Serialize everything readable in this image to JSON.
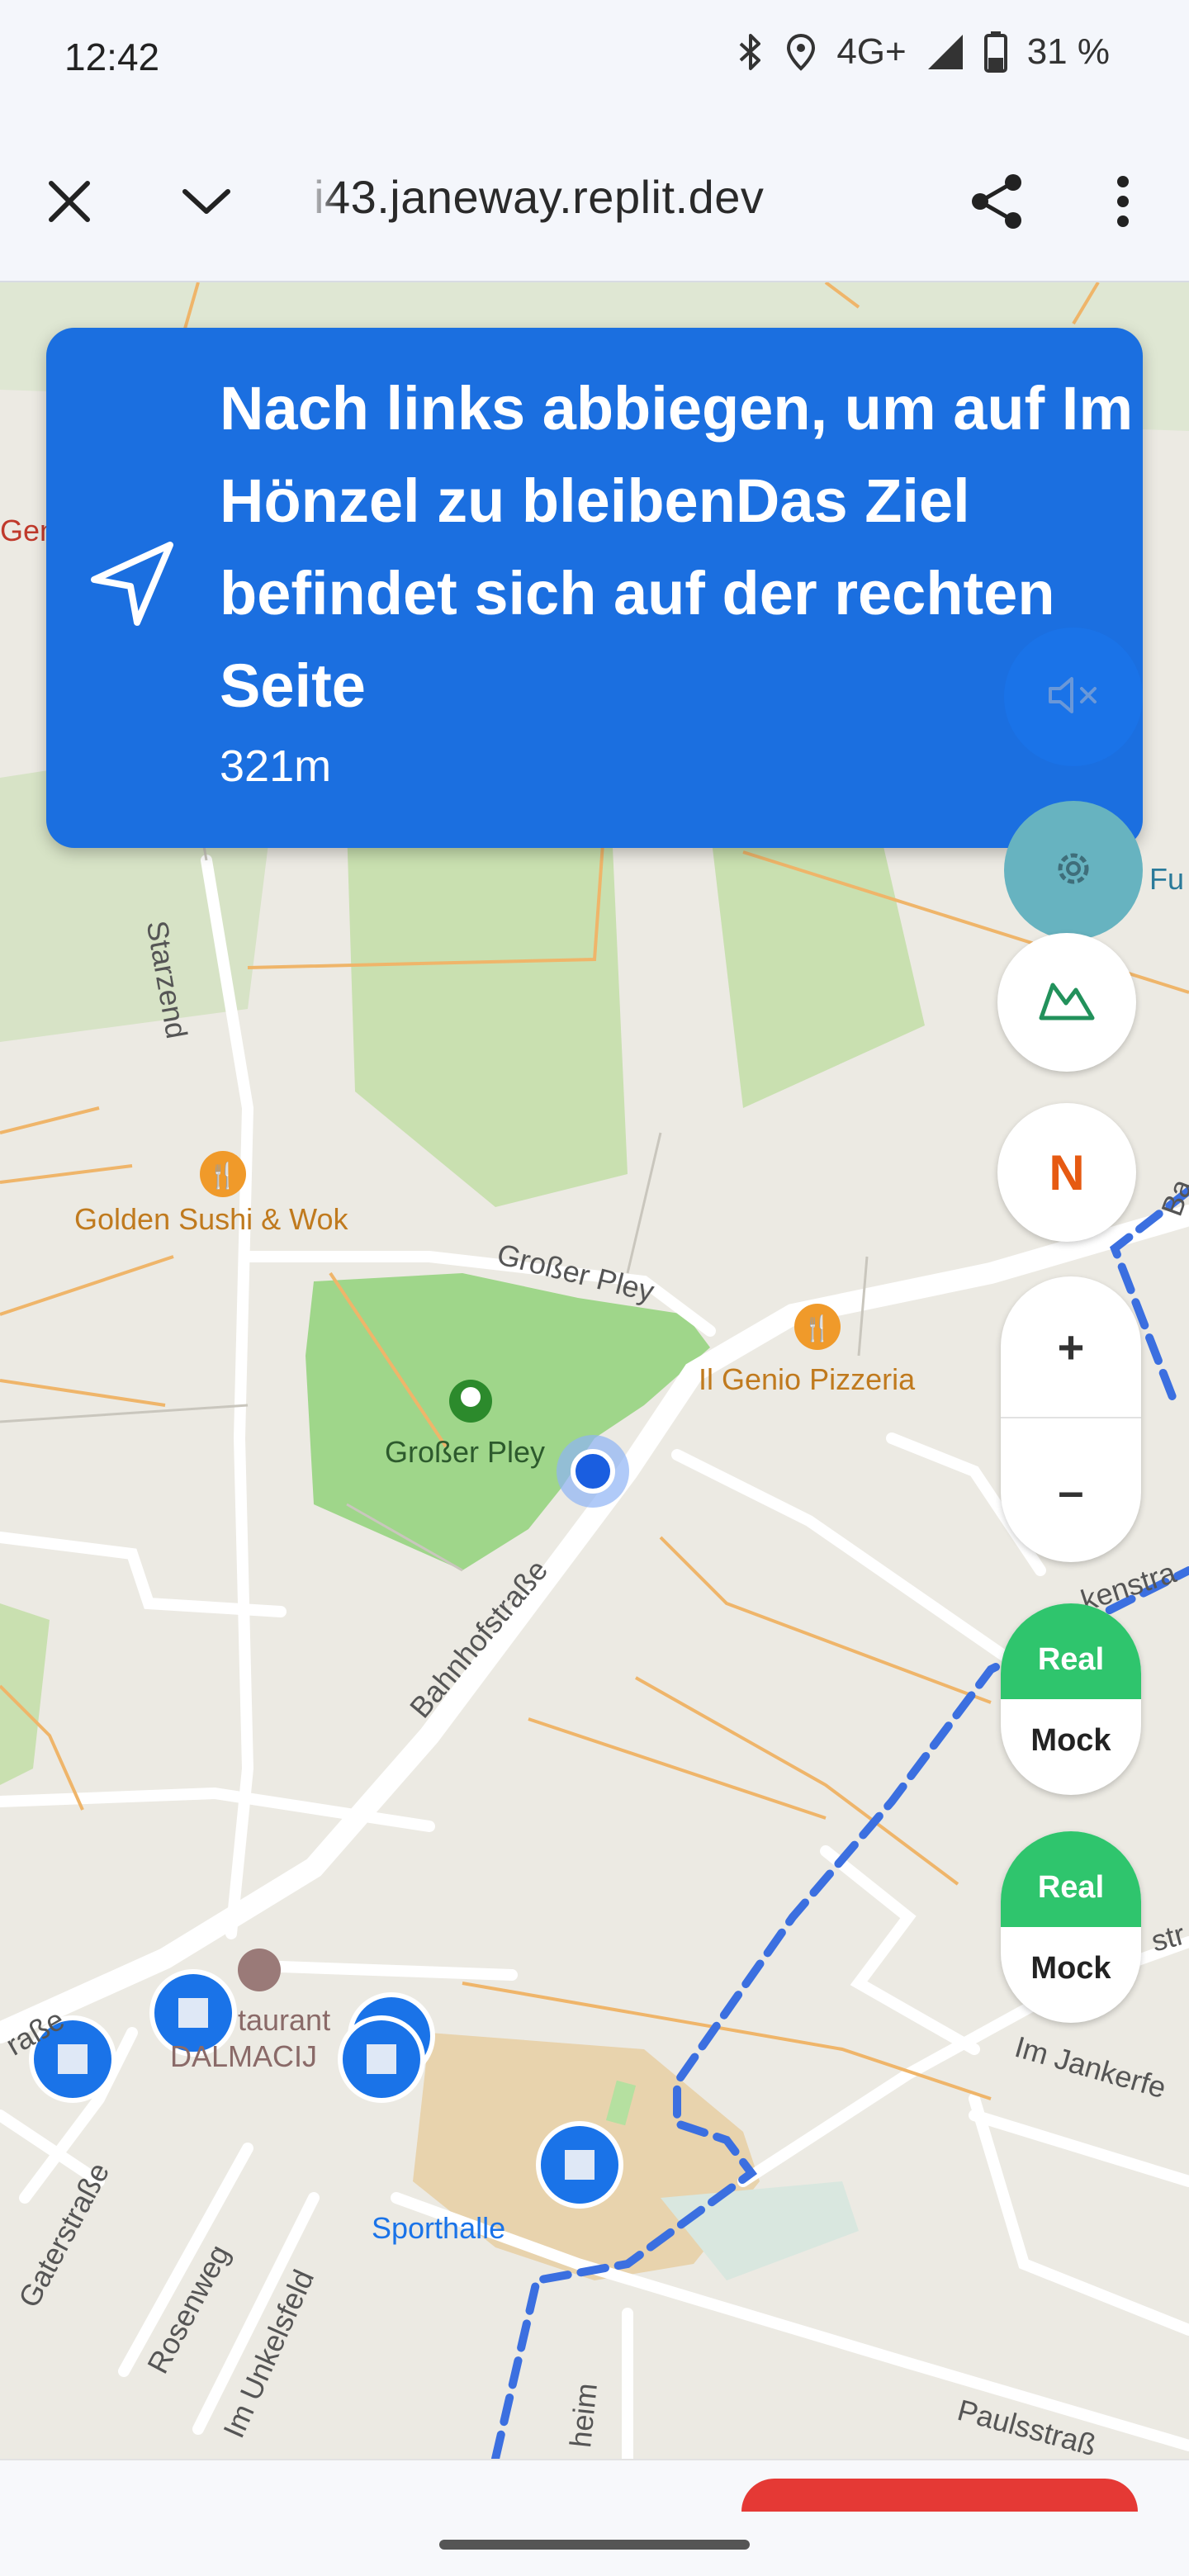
{
  "status_bar": {
    "time": "12:42",
    "network": "4G+",
    "battery": "31 %",
    "icons": [
      "bluetooth-icon",
      "location-icon",
      "signal-icon",
      "battery-icon"
    ]
  },
  "browser": {
    "url": "i43.janeway.replit.dev",
    "close_icon": "close-icon",
    "collapse_icon": "chevron-down-icon",
    "share_icon": "share-icon",
    "menu_icon": "more-vert-icon"
  },
  "navigation": {
    "instruction": "Nach links abbiegen, um auf Im Hönzel zu bleibenDas Ziel befindet sich auf der rechten Seite",
    "distance": "321m",
    "arrow_icon": "navigation-arrow-icon"
  },
  "controls": {
    "mute_icon": "volume-mute-icon",
    "settings_icon": "gear-icon",
    "terrain_icon": "mountain-icon",
    "north_label": "N",
    "zoom_in": "+",
    "zoom_out": "–",
    "toggle_1": {
      "top": "Real",
      "bottom": "Mock"
    },
    "toggle_2": {
      "top": "Real",
      "bottom": "Mock"
    }
  },
  "map": {
    "labels": {
      "gen": "Gen",
      "fu": "Fu",
      "starzend": "Starzend",
      "golden_sushi": "Golden Sushi & Wok",
      "grosser_pley_road": "Großer Pley",
      "il_genio": "Il Genio Pizzeria",
      "grosser_pley_park": "Großer Pley",
      "bahnhofstrasse": "Bahnhofstraße",
      "ba": "Ba",
      "kenstra": "kenstra",
      "str": "str",
      "strasse_left": "raße",
      "restaurant": "taurant",
      "dalmacija": "DALMACIJ",
      "im_jankerfe": "Im Jankerfe",
      "sporthalle": "Sporthalle",
      "gaterstrasse": "Gaterstraße",
      "rosenweg": "Rosenweg",
      "im_unkelsfeld": "Im Unkelsfeld",
      "heim": "heim",
      "paulsstrasse": "Paulsstraß"
    },
    "colors": {
      "route": "#3b6fe0",
      "park": "#9fd68a",
      "poi_food": "#f09a2a",
      "accent": "#1b6fe0"
    }
  }
}
